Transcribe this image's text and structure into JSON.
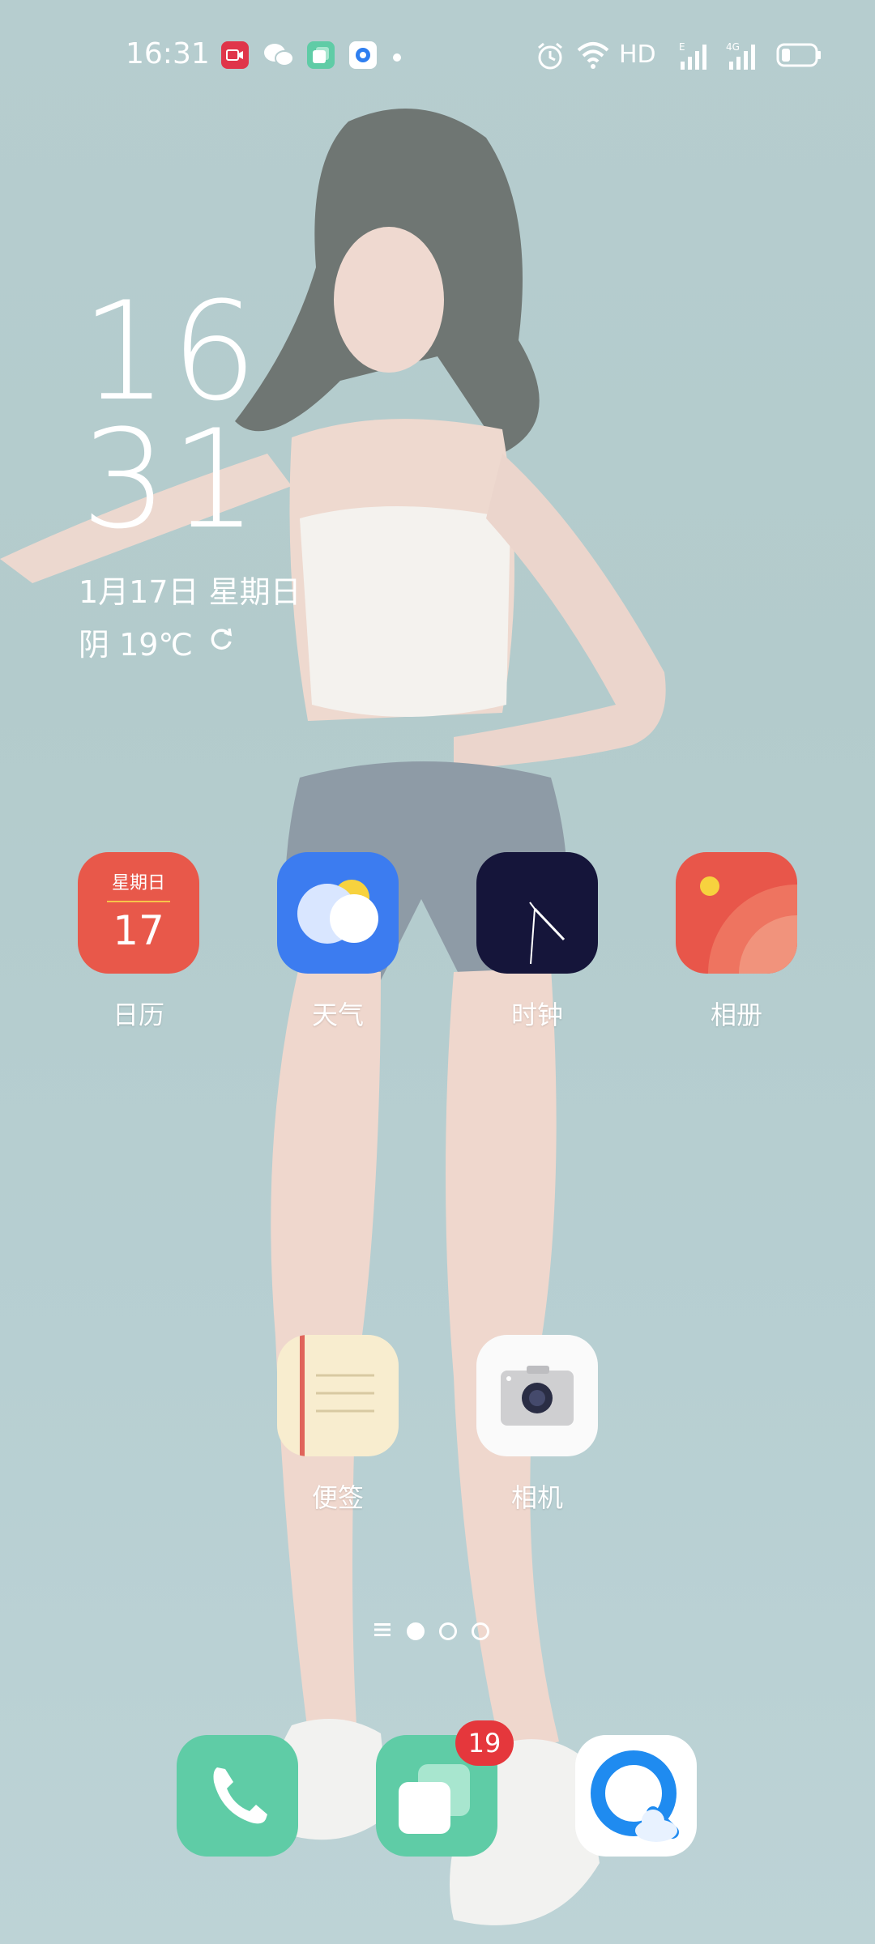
{
  "status_bar": {
    "time": "16:31",
    "network_label": "HD",
    "icons": [
      "screen-record-icon",
      "wechat-icon",
      "multitask-icon",
      "app-icon",
      "dot-icon",
      "alarm-icon",
      "wifi-icon",
      "signal-e-icon",
      "signal-4g-icon",
      "battery-icon"
    ]
  },
  "clock_widget": {
    "hour": "16",
    "minute": "31",
    "date": "1月17日 星期日",
    "weather": "阴 19℃"
  },
  "apps_row1": [
    {
      "label": "日历",
      "weekday": "星期日",
      "day": "17"
    },
    {
      "label": "天气"
    },
    {
      "label": "时钟"
    },
    {
      "label": "相册"
    }
  ],
  "apps_row2": [
    {
      "label": "便签"
    },
    {
      "label": "相机"
    }
  ],
  "page_indicator": {
    "pages": 3,
    "current": 1
  },
  "dock": {
    "badge": "19"
  },
  "colors": {
    "calendar": "#e8584a",
    "weather": "#3c7cf0",
    "clock": "#15153a",
    "gallery": "#e8564a",
    "phone": "#5fcca6",
    "multitask": "#5fcca6",
    "badge": "#e5373c"
  }
}
